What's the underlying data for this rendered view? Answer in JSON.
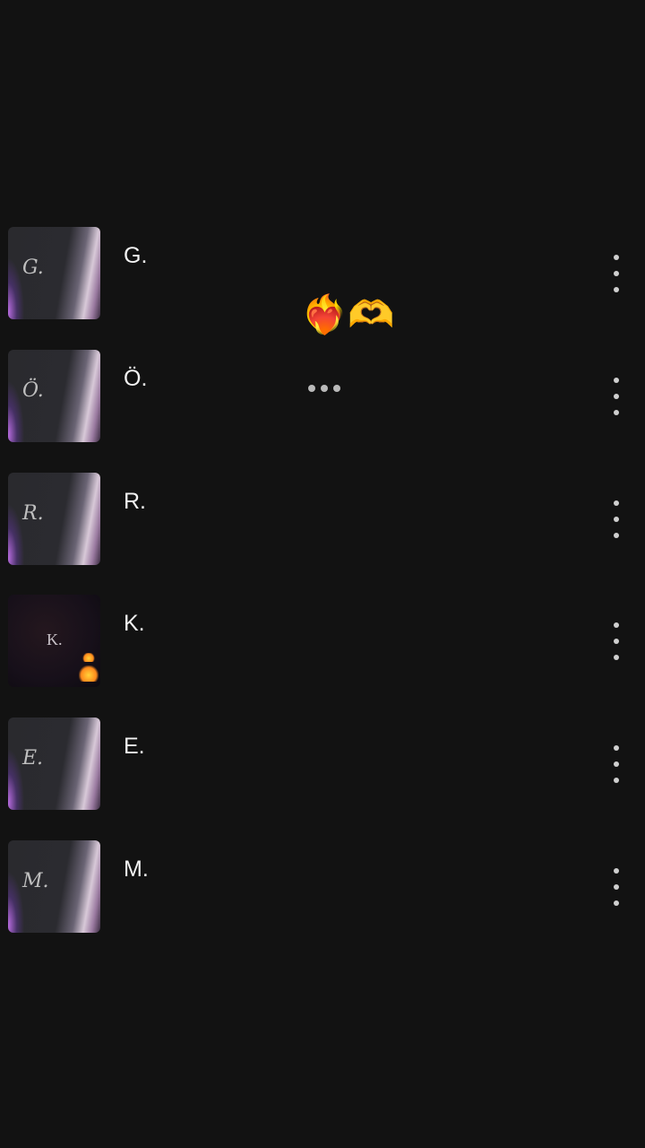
{
  "contacts": [
    {
      "name": "G.",
      "thumb_text": "G.",
      "style": "light"
    },
    {
      "name": "Ö.",
      "thumb_text": "Ö.",
      "style": "light"
    },
    {
      "name": "R.",
      "thumb_text": "R.",
      "style": "light"
    },
    {
      "name": "K.",
      "thumb_text": "K.",
      "style": "dark"
    },
    {
      "name": "E.",
      "thumb_text": "E.",
      "style": "light"
    },
    {
      "name": "M.",
      "thumb_text": "M.",
      "style": "light"
    }
  ],
  "overlay": {
    "emoji": "❤️‍🔥🫶"
  },
  "icons": {
    "more": "more-vert-icon",
    "typing": "typing-indicator-icon"
  },
  "colors": {
    "background": "#121212",
    "text": "#f2f2f2",
    "icon": "#cfcfcf"
  }
}
